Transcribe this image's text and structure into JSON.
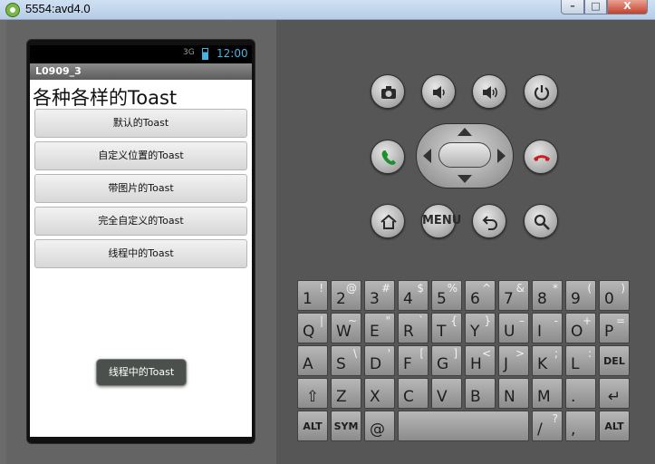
{
  "window": {
    "title": "5554:avd4.0",
    "minimize": "–",
    "maximize": "□",
    "close": "X"
  },
  "device": {
    "status_bar": {
      "signal": "3G",
      "time": "12:00"
    },
    "app_title": "L0909_3",
    "heading": "各种各样的Toast",
    "buttons": [
      {
        "label": "默认的Toast"
      },
      {
        "label": "自定义位置的Toast"
      },
      {
        "label": "带图片的Toast"
      },
      {
        "label": "完全自定义的Toast"
      },
      {
        "label": "线程中的Toast"
      }
    ],
    "toast": "线程中的Toast"
  },
  "controls": {
    "menu_label": "MENU"
  },
  "keyboard": {
    "rows": [
      [
        {
          "m": "1",
          "a": "!"
        },
        {
          "m": "2",
          "a": "@"
        },
        {
          "m": "3",
          "a": "#"
        },
        {
          "m": "4",
          "a": "$"
        },
        {
          "m": "5",
          "a": "%"
        },
        {
          "m": "6",
          "a": "^"
        },
        {
          "m": "7",
          "a": "&"
        },
        {
          "m": "8",
          "a": "*"
        },
        {
          "m": "9",
          "a": "("
        },
        {
          "m": "0",
          "a": ")"
        }
      ],
      [
        {
          "m": "Q",
          "a": "|"
        },
        {
          "m": "W",
          "a": "~"
        },
        {
          "m": "E",
          "a": "\""
        },
        {
          "m": "R",
          "a": "`"
        },
        {
          "m": "T",
          "a": "{"
        },
        {
          "m": "Y",
          "a": "}"
        },
        {
          "m": "U",
          "a": "–"
        },
        {
          "m": "I",
          "a": "-"
        },
        {
          "m": "O",
          "a": "+"
        },
        {
          "m": "P",
          "a": "="
        }
      ],
      [
        {
          "m": "A",
          "a": ""
        },
        {
          "m": "S",
          "a": "\\"
        },
        {
          "m": "D",
          "a": "'"
        },
        {
          "m": "F",
          "a": "["
        },
        {
          "m": "G",
          "a": "]"
        },
        {
          "m": "H",
          "a": "<"
        },
        {
          "m": "J",
          "a": ">"
        },
        {
          "m": "K",
          "a": ";"
        },
        {
          "m": "L",
          "a": ":"
        },
        {
          "m": "DEL",
          "a": ""
        }
      ],
      [
        {
          "m": "⇧",
          "a": ""
        },
        {
          "m": "Z",
          "a": ""
        },
        {
          "m": "X",
          "a": ""
        },
        {
          "m": "C",
          "a": ""
        },
        {
          "m": "V",
          "a": ""
        },
        {
          "m": "B",
          "a": ""
        },
        {
          "m": "N",
          "a": ""
        },
        {
          "m": "M",
          "a": ""
        },
        {
          "m": ".",
          "a": ""
        },
        {
          "m": "↵",
          "a": ""
        }
      ],
      [
        {
          "m": "ALT",
          "a": ""
        },
        {
          "m": "SYM",
          "a": ""
        },
        {
          "m": "@",
          "a": ""
        },
        {
          "m": "",
          "a": ""
        },
        {
          "m": "/",
          "a": "?"
        },
        {
          "m": ",",
          "a": ""
        },
        {
          "m": "ALT",
          "a": ""
        }
      ]
    ]
  }
}
